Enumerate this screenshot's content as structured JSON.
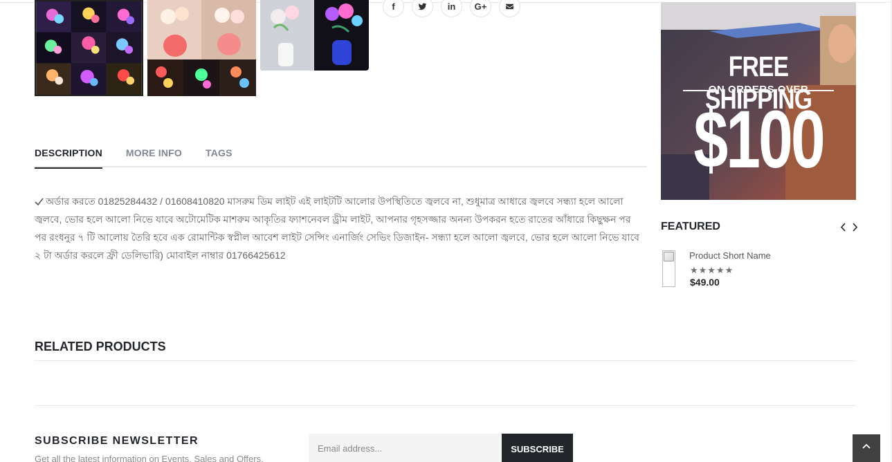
{
  "gallery": {
    "thumbnails": [
      {
        "icon": "mushroom-lamp-collage-image"
      },
      {
        "icon": "rose-lamp-collage-image"
      },
      {
        "icon": "flower-plug-lamp-image"
      }
    ]
  },
  "share": {
    "icons": [
      "facebook-icon",
      "twitter-icon",
      "linkedin-icon",
      "google-plus-icon",
      "email-icon"
    ],
    "labels": {
      "facebook": "f",
      "linkedin": "in",
      "google_plus": "G+"
    }
  },
  "tabs": [
    {
      "label": "DESCRIPTION",
      "active": true
    },
    {
      "label": "MORE INFO",
      "active": false
    },
    {
      "label": "TAGS",
      "active": false
    }
  ],
  "description": {
    "check_icon": "check-icon",
    "text": "অর্ডার করতে 01825284432 / 01608410820 মাসরুম ডিম লাইট এই লাইটটি আলোর উপস্থিতিতে জ্বলবে না, শুধুমাত্র আধারে জ্বলবে সন্ধ্যা হলে আলো জ্বলবে, ভোর হলে আলো নিভে যাবে অটোমেটিক মাশরুম আকৃতির ফ্যাশনেবল ড্রীম লাইট, আপনার গৃহসজ্জার অনন্য উপকরন হতে রাতের আঁধারে কিছুক্ষন পর পর রংধনুর ৭ টি আলোয় তৈরি হবে এক রোমান্টিক স্বপ্নীল আবেশ লাইট সেন্সিং এনার্জিং সেভিং ডিজাইন- সন্ধ্যা হলে আলো জ্বলবে, ভোর হলে আলো নিভে যাবে ২ টা অর্ডার করলে ফ্রী ডেলিভারি) মোবাইল নাম্বার 01766425612"
  },
  "promo": {
    "line1": "FREE SHIPPING",
    "line2": "ON ORDERS OVER",
    "line3": "$100"
  },
  "featured": {
    "title": "FEATURED",
    "prev_icon": "chevron-left-icon",
    "next_icon": "chevron-right-icon",
    "product": {
      "name": "Product Short Name",
      "rating_stars": "★★★★★",
      "rating": 5,
      "price": "$49.00"
    }
  },
  "related": {
    "title": "RELATED PRODUCTS"
  },
  "newsletter": {
    "title": "SUBSCRIBE NEWSLETTER",
    "subtitle": "Get all the latest information on Events, Sales and Offers.",
    "placeholder": "Email address...",
    "button": "SUBSCRIBE"
  },
  "scroll_top": {
    "icon": "chevron-up-icon"
  }
}
